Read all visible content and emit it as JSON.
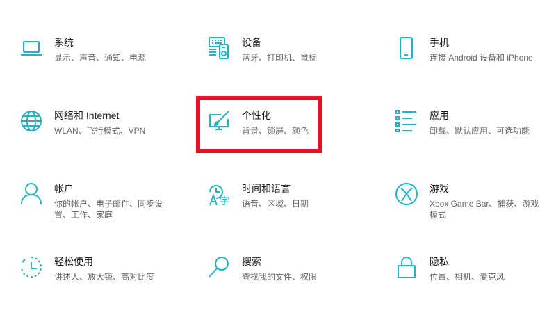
{
  "accent": "#1fb3c3",
  "highlight_color": "#e81123",
  "tiles": [
    {
      "title": "系统",
      "desc": "显示、声音、通知、电源",
      "icon": "laptop-icon"
    },
    {
      "title": "设备",
      "desc": "蓝牙、打印机、鼠标",
      "icon": "devices-icon"
    },
    {
      "title": "手机",
      "desc": "连接 Android 设备和 iPhone",
      "icon": "phone-icon"
    },
    {
      "title": "网络和 Internet",
      "desc": "WLAN、飞行模式、VPN",
      "icon": "globe-icon"
    },
    {
      "title": "个性化",
      "desc": "背景、锁屏、颜色",
      "icon": "personalization-icon"
    },
    {
      "title": "应用",
      "desc": "卸载、默认应用、可选功能",
      "icon": "apps-list-icon"
    },
    {
      "title": "帐户",
      "desc": "你的帐户、电子邮件、同步设\n置、工作、家庭",
      "icon": "person-icon"
    },
    {
      "title": "时间和语言",
      "desc": "语音、区域、日期",
      "icon": "time-language-icon"
    },
    {
      "title": "游戏",
      "desc": "Xbox Game Bar、捕获、游戏\n模式",
      "icon": "xbox-icon"
    },
    {
      "title": "轻松使用",
      "desc": "讲述人、放大镜、高对比度",
      "icon": "ease-of-access-icon"
    },
    {
      "title": "搜索",
      "desc": "查找我的文件、权限",
      "icon": "search-icon"
    },
    {
      "title": "隐私",
      "desc": "位置、相机、麦克风",
      "icon": "lock-icon"
    }
  ]
}
